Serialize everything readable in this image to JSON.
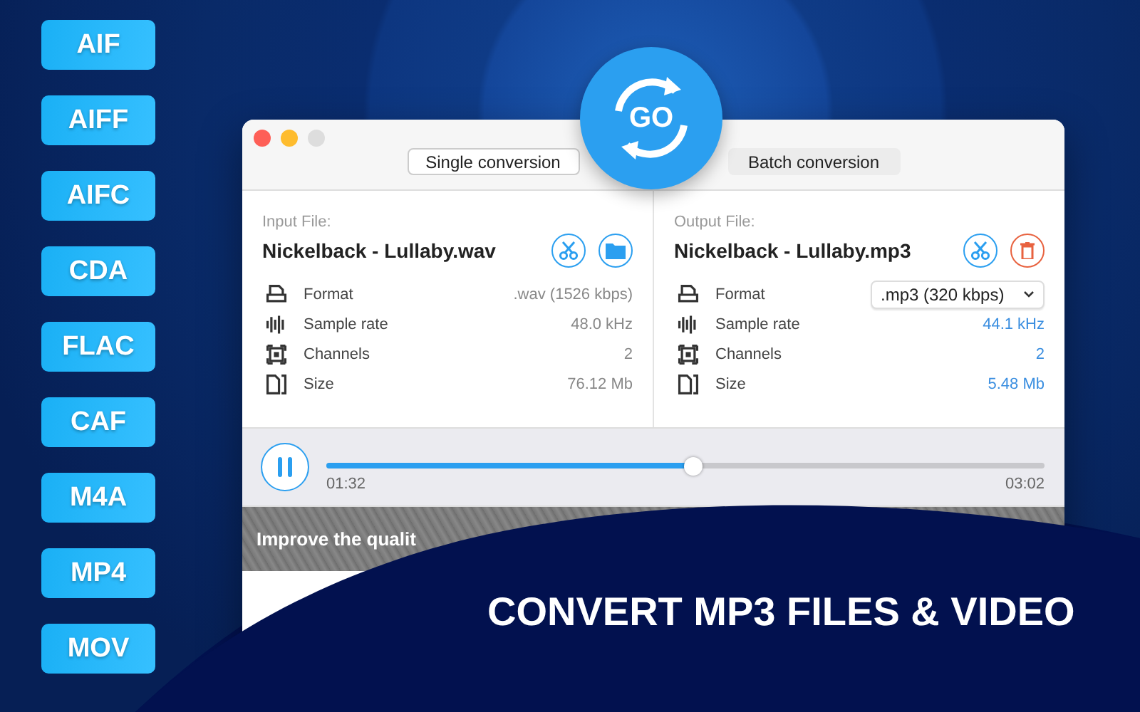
{
  "format_badges": [
    {
      "label": "AIF"
    },
    {
      "label": "AIFF"
    },
    {
      "label": "AIFC"
    },
    {
      "label": "CDA"
    },
    {
      "label": "FLAC"
    },
    {
      "label": "CAF"
    },
    {
      "label": "M4A"
    },
    {
      "label": "MP4"
    },
    {
      "label": "MOV"
    }
  ],
  "window": {
    "tabs": [
      {
        "label": "Single conversion",
        "selected": true
      },
      {
        "label": "Batch conversion",
        "selected": false
      }
    ],
    "go_button": {
      "label": "GO"
    },
    "input": {
      "heading": "Input File:",
      "file_name": "Nickelback - Lullaby.wav",
      "actions": [
        {
          "kind": "cut"
        },
        {
          "kind": "folder"
        }
      ],
      "properties": [
        {
          "kind": "format",
          "label": "Format",
          "value": ".wav (1526 kbps)",
          "highlighted": false,
          "dropdown": false
        },
        {
          "kind": "sample_rate",
          "label": "Sample rate",
          "value": "48.0 kHz",
          "highlighted": false,
          "dropdown": false
        },
        {
          "kind": "channels",
          "label": "Channels",
          "value": "2",
          "highlighted": false,
          "dropdown": false
        },
        {
          "kind": "size",
          "label": "Size",
          "value": "76.12 Mb",
          "highlighted": false,
          "dropdown": false
        }
      ]
    },
    "output": {
      "heading": "Output File:",
      "file_name": "Nickelback - Lullaby.mp3",
      "actions": [
        {
          "kind": "cut"
        },
        {
          "kind": "delete"
        }
      ],
      "properties": [
        {
          "kind": "format",
          "label": "Format",
          "value": ".mp3 (320 kbps)",
          "highlighted": false,
          "dropdown": true
        },
        {
          "kind": "sample_rate",
          "label": "Sample rate",
          "value": "44.1 kHz",
          "highlighted": true,
          "dropdown": false
        },
        {
          "kind": "channels",
          "label": "Channels",
          "value": "2",
          "highlighted": true,
          "dropdown": false
        },
        {
          "kind": "size",
          "label": "Size",
          "value": "5.48 Mb",
          "highlighted": true,
          "dropdown": false
        }
      ]
    },
    "player": {
      "playing": true,
      "level": 0.51,
      "elapsed": "01:32",
      "total": "03:02"
    },
    "banner": {
      "text": "Improve the qualit"
    }
  },
  "headline": "CONVERT MP3 FILES & VIDEO"
}
